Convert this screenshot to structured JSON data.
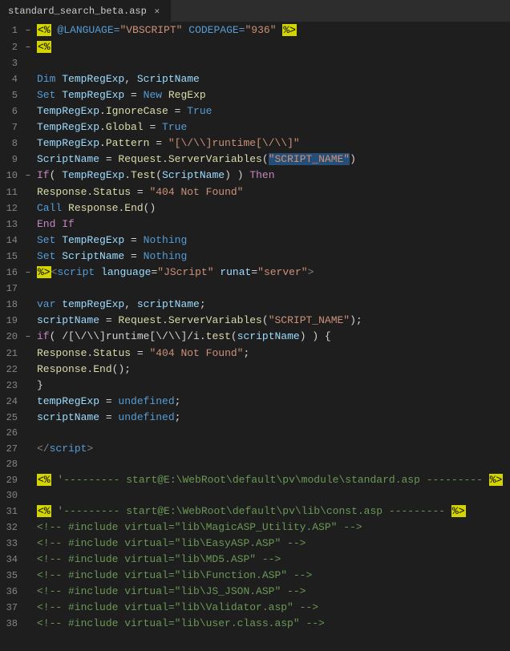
{
  "tab": {
    "filename": "standard_search_beta.asp",
    "modified": false,
    "close_icon": "✕"
  },
  "lines": [
    {
      "num": 1,
      "fold": "−",
      "content": "asp_open_line"
    },
    {
      "num": 2,
      "fold": "−",
      "content": "asp_block_start"
    },
    {
      "num": 3,
      "fold": "",
      "content": "blank"
    },
    {
      "num": 4,
      "fold": "",
      "content": "dim_line"
    },
    {
      "num": 5,
      "fold": "",
      "content": "set_regexp"
    },
    {
      "num": 6,
      "fold": "",
      "content": "ignorecase"
    },
    {
      "num": 7,
      "fold": "",
      "content": "global"
    },
    {
      "num": 8,
      "fold": "",
      "content": "pattern"
    },
    {
      "num": 9,
      "fold": "",
      "content": "scriptname_assign"
    },
    {
      "num": 10,
      "fold": "−",
      "content": "if_then"
    },
    {
      "num": 11,
      "fold": "",
      "content": "response_status"
    },
    {
      "num": 12,
      "fold": "",
      "content": "call_end"
    },
    {
      "num": 13,
      "fold": "",
      "content": "end_if"
    },
    {
      "num": 14,
      "fold": "",
      "content": "set_nothing1"
    },
    {
      "num": 15,
      "fold": "",
      "content": "set_nothing2"
    },
    {
      "num": 16,
      "fold": "−",
      "content": "asp_script_open"
    },
    {
      "num": 17,
      "fold": "",
      "content": "blank"
    },
    {
      "num": 18,
      "fold": "",
      "content": "var_decl"
    },
    {
      "num": 19,
      "fold": "",
      "content": "scriptname_js"
    },
    {
      "num": 20,
      "fold": "−",
      "content": "if_js"
    },
    {
      "num": 21,
      "fold": "",
      "content": "response_status_js"
    },
    {
      "num": 22,
      "fold": "",
      "content": "response_end_js"
    },
    {
      "num": 23,
      "fold": "",
      "content": "close_brace"
    },
    {
      "num": 24,
      "fold": "",
      "content": "temp_undefined"
    },
    {
      "num": 25,
      "fold": "",
      "content": "script_undefined"
    },
    {
      "num": 26,
      "fold": "",
      "content": "blank"
    },
    {
      "num": 27,
      "fold": "",
      "content": "script_close"
    },
    {
      "num": 28,
      "fold": "",
      "content": "blank"
    },
    {
      "num": 29,
      "fold": "",
      "content": "comment_start1"
    },
    {
      "num": 30,
      "fold": "",
      "content": "blank"
    },
    {
      "num": 31,
      "fold": "",
      "content": "comment_start2"
    },
    {
      "num": 32,
      "fold": "",
      "content": "include1"
    },
    {
      "num": 33,
      "fold": "",
      "content": "include2"
    },
    {
      "num": 34,
      "fold": "",
      "content": "include3"
    },
    {
      "num": 35,
      "fold": "",
      "content": "include4"
    },
    {
      "num": 36,
      "fold": "",
      "content": "include5"
    },
    {
      "num": 37,
      "fold": "",
      "content": "include6"
    },
    {
      "num": 38,
      "fold": "",
      "content": "include7"
    }
  ]
}
